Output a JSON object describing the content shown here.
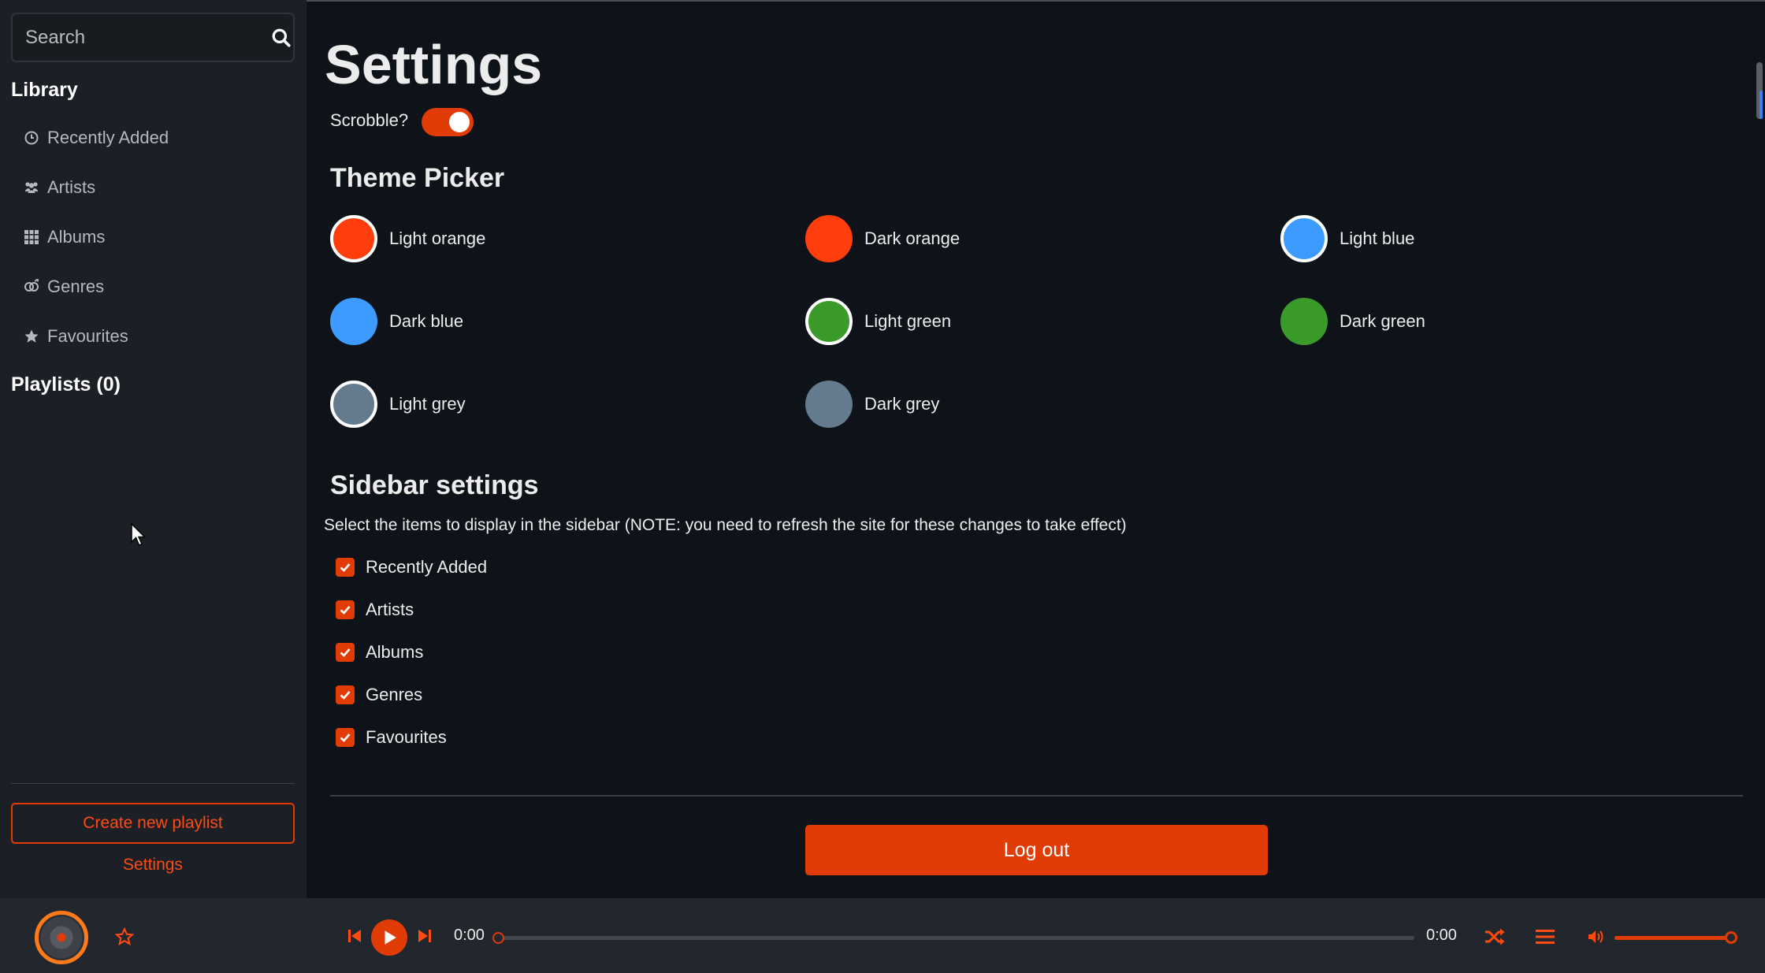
{
  "search": {
    "placeholder": "Search"
  },
  "sidebar": {
    "library_title": "Library",
    "items": [
      {
        "label": "Recently Added",
        "icon": "clock-icon"
      },
      {
        "label": "Artists",
        "icon": "users-icon"
      },
      {
        "label": "Albums",
        "icon": "grid-icon"
      },
      {
        "label": "Genres",
        "icon": "genres-icon"
      },
      {
        "label": "Favourites",
        "icon": "star-icon"
      }
    ],
    "playlists_title": "Playlists (0)",
    "create_playlist_label": "Create new playlist",
    "settings_label": "Settings"
  },
  "main": {
    "title": "Settings",
    "scrobble_label": "Scrobble?",
    "scrobble_on": true,
    "theme_title": "Theme Picker",
    "themes": [
      {
        "label": "Light orange",
        "color": "#ff3d0d",
        "selected": true
      },
      {
        "label": "Dark orange",
        "color": "#ff3d0d",
        "selected": false
      },
      {
        "label": "Light blue",
        "color": "#3d9bff",
        "selected": true
      },
      {
        "label": "Dark blue",
        "color": "#3d9bff",
        "selected": false
      },
      {
        "label": "Light green",
        "color": "#3a9b2a",
        "selected": true
      },
      {
        "label": "Dark green",
        "color": "#3a9b2a",
        "selected": false
      },
      {
        "label": "Light grey",
        "color": "#637b8c",
        "selected": true
      },
      {
        "label": "Dark grey",
        "color": "#637b8c",
        "selected": false
      }
    ],
    "sidebar_settings_title": "Sidebar settings",
    "sidebar_settings_hint": "Select the items to display in the sidebar (NOTE: you need to refresh the site for these changes to take effect)",
    "sidebar_options": [
      {
        "label": "Recently Added",
        "checked": true
      },
      {
        "label": "Artists",
        "checked": true
      },
      {
        "label": "Albums",
        "checked": true
      },
      {
        "label": "Genres",
        "checked": true
      },
      {
        "label": "Favourites",
        "checked": true
      }
    ],
    "logout_label": "Log out"
  },
  "player": {
    "current_time": "0:00",
    "total_time": "0:00",
    "progress": 0,
    "volume": 1.0
  },
  "colors": {
    "accent": "#e23c06",
    "background": "#0e1219",
    "sidebar": "#1c2026",
    "player": "#22262d"
  }
}
